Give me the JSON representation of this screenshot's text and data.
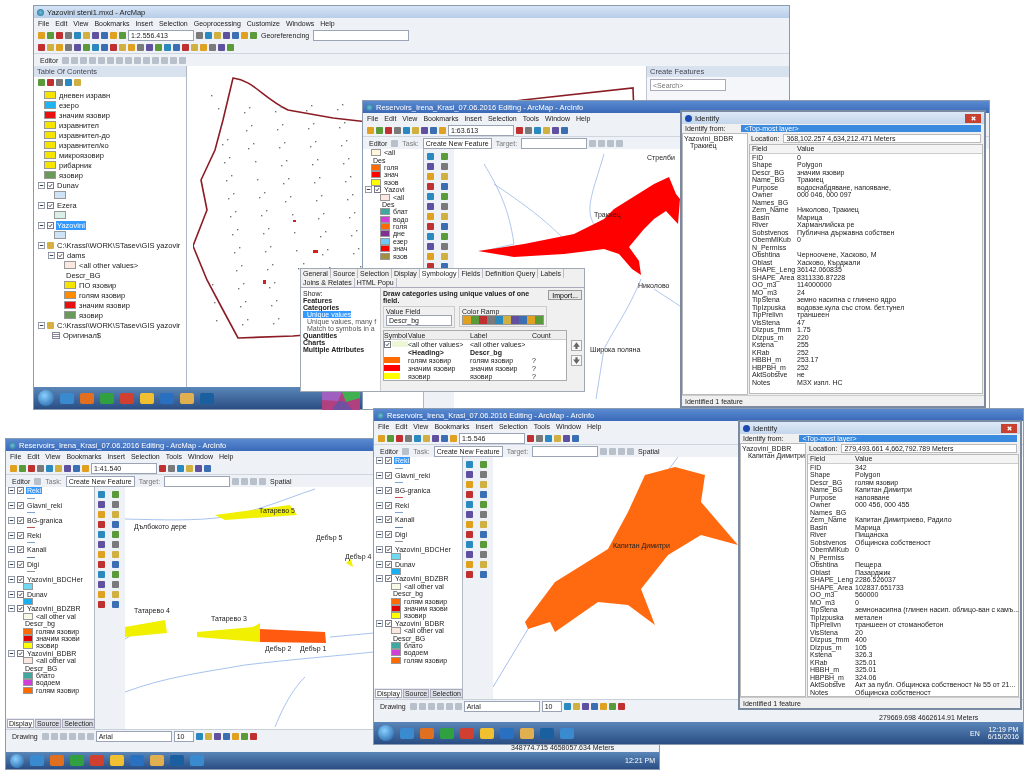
{
  "main_window": {
    "title": "Yazovini steni1.mxd - ArcMap",
    "menu": [
      "File",
      "Edit",
      "View",
      "Bookmarks",
      "Insert",
      "Selection",
      "Geoprocessing",
      "Customize",
      "Windows",
      "Help"
    ],
    "scale": "1:2.556.413",
    "georeferencing": "Georeferencing",
    "editor": "Editor",
    "toc_title": "Table Of Contents",
    "toc": [
      {
        "kind": "legend",
        "color": "#f5e400",
        "label": "дневен изравн"
      },
      {
        "kind": "legend",
        "color": "#1eb4f0",
        "label": "езеро"
      },
      {
        "kind": "legend",
        "color": "#e81010",
        "label": "значим язовир"
      },
      {
        "kind": "legend",
        "color": "#f5e400",
        "label": "изравнител"
      },
      {
        "kind": "legend",
        "color": "#f5e400",
        "label": "изравнител-до"
      },
      {
        "kind": "legend",
        "color": "#f5e400",
        "label": "изравнител/ко"
      },
      {
        "kind": "legend",
        "color": "#f5e400",
        "label": "микроязовир"
      },
      {
        "kind": "legend",
        "color": "#f5e400",
        "label": "рибарник"
      },
      {
        "kind": "legend",
        "color": "#6a9a5a",
        "label": "язовир"
      },
      {
        "kind": "layer",
        "name": "Dunav",
        "checked": true,
        "selected": false,
        "expanded": true,
        "children": [
          {
            "kind": "legend",
            "color": "#cfe3f7"
          }
        ]
      },
      {
        "kind": "layer",
        "name": "Ezera",
        "checked": true,
        "selected": false,
        "expanded": true,
        "children": [
          {
            "kind": "legend",
            "color": "#d8f0e8"
          }
        ]
      },
      {
        "kind": "layer",
        "name": "Yazovini",
        "checked": true,
        "selected": true,
        "expanded": true,
        "children": [
          {
            "kind": "legend",
            "color": "#cfe3f7"
          }
        ]
      },
      {
        "kind": "group",
        "name": "C:\\Krassi\\WORK\\STasev\\GIS yazovir",
        "expanded": true,
        "children": [
          {
            "kind": "layer",
            "name": "dams",
            "checked": true,
            "selected": false,
            "expanded": true,
            "children": [
              {
                "kind": "legend",
                "color": "#fbe8e0",
                "label": "<all other values>"
              },
              {
                "kind": "heading",
                "label": "Descr_BG"
              },
              {
                "kind": "legend",
                "color": "#f5e400",
                "label": "ПО язовир"
              },
              {
                "kind": "legend",
                "color": "#ff8c00",
                "label": "голям язовир"
              },
              {
                "kind": "legend",
                "color": "#e81010",
                "label": "значим язовир"
              },
              {
                "kind": "legend",
                "color": "#6a9a5a",
                "label": "язовир"
              }
            ]
          }
        ]
      },
      {
        "kind": "group",
        "name": "C:\\Krassi\\WORK\\STasev\\GIS yazovir",
        "expanded": true,
        "children": [
          {
            "kind": "table",
            "label": "Оригинал$"
          }
        ]
      }
    ],
    "create_features": {
      "title": "Create Features",
      "placeholder": "<Search>"
    }
  },
  "layer_properties": {
    "tabs": [
      {
        "label": "General",
        "selected": false
      },
      {
        "label": "Source",
        "selected": false
      },
      {
        "label": "Selection",
        "selected": false
      },
      {
        "label": "Display",
        "selected": false
      },
      {
        "label": "Symbology",
        "selected": true
      },
      {
        "label": "Fields",
        "selected": false
      },
      {
        "label": "Definition Query",
        "selected": false
      },
      {
        "label": "Labels",
        "selected": false
      },
      {
        "label": "Joins & Relates",
        "selected": false
      },
      {
        "label": "HTML Popu",
        "selected": false
      }
    ],
    "show_label": "Show:",
    "show_items": [
      {
        "kind": "heading",
        "label": "Features",
        "selected": false
      },
      {
        "kind": "heading",
        "label": "Categories",
        "selected": false
      },
      {
        "kind": "item",
        "label": "Unique values",
        "selected": true
      },
      {
        "kind": "item",
        "label": "Unique values, many f",
        "selected": false
      },
      {
        "kind": "item",
        "label": "Match to symbols in a",
        "selected": false
      },
      {
        "kind": "heading",
        "label": "Quantities",
        "selected": false
      },
      {
        "kind": "heading",
        "label": "Charts",
        "selected": false
      },
      {
        "kind": "heading",
        "label": "Multiple Attributes",
        "selected": false
      }
    ],
    "description": "Draw categories using unique values of one field.",
    "import": "Import...",
    "value_field_label": "Value Field",
    "value_field": "Descr_bg",
    "color_ramp_label": "Color Ramp",
    "columns": [
      "Symbol",
      "Value",
      "Label",
      "Count"
    ],
    "rows": [
      {
        "kind": "check",
        "checked": true,
        "color": "#eef6d8",
        "value": "<all other values>",
        "label": "<all other values>"
      },
      {
        "kind": "heading",
        "value": "<Heading>",
        "label": "Descr_bg"
      },
      {
        "kind": "symbol",
        "color": "#ff6a00",
        "value": "голям язовир",
        "label": "голям язовир",
        "count": "?"
      },
      {
        "kind": "symbol",
        "color": "#ff0000",
        "value": "значим язовир",
        "label": "значим язовир",
        "count": "?"
      },
      {
        "kind": "symbol",
        "color": "#ffff00",
        "value": "язовир",
        "label": "язовир",
        "count": "?"
      }
    ]
  },
  "arcinfo_windows": [
    {
      "title": "Reservoirs_Irena_Krasi_07.06.2016 Editing - ArcMap - ArcInfo",
      "menu": [
        "File",
        "Edit",
        "View",
        "Bookmarks",
        "Insert",
        "Selection",
        "Tools",
        "Window",
        "Help"
      ],
      "scale": "1:63.613",
      "editor": "Editor",
      "task_label": "Task:",
      "task": "Create New Feature",
      "target_label": "Target:",
      "toc": [
        {
          "kind": "legend",
          "color": "#fff6dc",
          "label": "<all"
        },
        {
          "kind": "heading",
          "label": "Des"
        },
        {
          "kind": "legend",
          "color": "#ff6a00",
          "label": "голя"
        },
        {
          "kind": "legend",
          "color": "#ff0000",
          "label": "знач"
        },
        {
          "kind": "legend",
          "color": "#ffff00",
          "label": "язов"
        },
        {
          "kind": "layer",
          "name": "Yazovi",
          "checked": true,
          "selected": false,
          "expanded": true,
          "children": [
            {
              "kind": "legend",
              "color": "#fbe8e0",
              "label": "<all"
            },
            {
              "kind": "heading",
              "label": "Des"
            },
            {
              "kind": "legend",
              "color": "#3fa8a0",
              "label": "блат"
            },
            {
              "kind": "legend",
              "color": "#d040d8",
              "label": "водо"
            },
            {
              "kind": "legend",
              "color": "#ff6a00",
              "label": "голя"
            },
            {
              "kind": "legend",
              "color": "#803090",
              "label": "дне"
            },
            {
              "kind": "legend",
              "color": "#70c8f8",
              "label": "езер"
            },
            {
              "kind": "legend",
              "color": "#ff0000",
              "label": "знач"
            },
            {
              "kind": "legend",
              "color": "#a09040",
              "label": "язов"
            }
          ]
        }
      ],
      "map": {
        "kind": "red_reservoir",
        "labels": [
          "Стрелби",
          "Тракиец",
          "Николово",
          "Широка поляна"
        ]
      }
    },
    {
      "title": "Reservoirs_Irena_Krasi_07.06.2016 Editing - ArcMap - ArcInfo",
      "menu": [
        "File",
        "Edit",
        "View",
        "Bookmarks",
        "Insert",
        "Selection",
        "Tools",
        "Window",
        "Help"
      ],
      "scale": "1:41.540",
      "editor": "Editor",
      "task_label": "Task:",
      "task": "Create New Feature",
      "target_label": "Target:",
      "spatial": "Spatial",
      "toc": [
        {
          "kind": "layer",
          "name": "Reki",
          "checked": true,
          "selected": true,
          "expanded": true,
          "children": [
            {
              "kind": "line",
              "color": "#7aa6d6"
            }
          ]
        },
        {
          "kind": "layer",
          "name": "Glavni_reki",
          "checked": true,
          "selected": false,
          "expanded": true,
          "children": [
            {
              "kind": "line",
              "color": "#7aa6d6"
            }
          ]
        },
        {
          "kind": "layer",
          "name": "BG-granica",
          "checked": true,
          "selected": false,
          "expanded": true,
          "children": [
            {
              "kind": "line",
              "color": "#c85050"
            }
          ]
        },
        {
          "kind": "layer",
          "name": "Reki",
          "checked": true,
          "selected": false,
          "expanded": true,
          "children": [
            {
              "kind": "line",
              "color": "#7aa6d6"
            }
          ]
        },
        {
          "kind": "layer",
          "name": "Kanali",
          "checked": true,
          "selected": false,
          "expanded": true,
          "children": [
            {
              "kind": "line",
              "color": "#6080a0"
            }
          ]
        },
        {
          "kind": "layer",
          "name": "Digi",
          "checked": true,
          "selected": false,
          "expanded": true,
          "children": [
            {
              "kind": "line",
              "color": "#909090"
            }
          ]
        },
        {
          "kind": "layer",
          "name": "Yazovini_BDCHer",
          "checked": true,
          "selected": false,
          "expanded": true,
          "children": [
            {
              "kind": "legend",
              "color": "#70d8f0"
            }
          ]
        },
        {
          "kind": "layer",
          "name": "Dunav",
          "checked": true,
          "selected": false,
          "expanded": true,
          "children": [
            {
              "kind": "legend",
              "color": "#18b0f0"
            }
          ]
        },
        {
          "kind": "layer",
          "name": "Yazovini_BDZBR",
          "checked": true,
          "selected": false,
          "expanded": true,
          "children": [
            {
              "kind": "legend",
              "color": "#f6fbe8",
              "label": "<all other val"
            },
            {
              "kind": "heading",
              "label": "Descr_bg"
            },
            {
              "kind": "legend",
              "color": "#ff6a00",
              "label": "голям язовир"
            },
            {
              "kind": "legend",
              "color": "#e00000",
              "label": "значим язови"
            },
            {
              "kind": "legend",
              "color": "#ffff00",
              "label": "язовир"
            }
          ]
        },
        {
          "kind": "layer",
          "name": "Yazovini_BDBR",
          "checked": true,
          "selected": false,
          "expanded": true,
          "children": [
            {
              "kind": "legend",
              "color": "#fbe8e0",
              "label": "<all other val"
            },
            {
              "kind": "heading",
              "label": "Descr_BG"
            },
            {
              "kind": "legend",
              "color": "#3fa8a0",
              "label": "блато"
            },
            {
              "kind": "legend",
              "color": "#d040d8",
              "label": "водоем"
            },
            {
              "kind": "legend",
              "color": "#ff6a00",
              "label": "голям язовир"
            }
          ]
        }
      ],
      "toc_tabs": [
        {
          "label": "Display",
          "selected": true
        },
        {
          "label": "Source",
          "selected": false
        },
        {
          "label": "Selection",
          "selected": false
        }
      ],
      "drawing": {
        "label": "Drawing",
        "font": "Arial",
        "size": "10"
      },
      "map": {
        "kind": "strips",
        "labels": [
          "Татарево 5",
          "Дълбокото дере",
          "Дебър 5",
          "Дебър 4",
          "Татарево 4",
          "Татарево 3",
          "Дебър 2",
          "Дебър 1"
        ]
      },
      "status": "348774.715 4658057.634 Meters",
      "clock": "12:21 PM"
    },
    {
      "title": "Reservoirs_Irena_Krasi_07.06.2016 Editing - ArcMap - ArcInfo",
      "menu": [
        "File",
        "Edit",
        "View",
        "Bookmarks",
        "Insert",
        "Selection",
        "Tools",
        "Window",
        "Help"
      ],
      "scale": "1:5.546",
      "editor": "Editor",
      "task_label": "Task:",
      "task": "Create New Feature",
      "target_label": "Target:",
      "spatial": "Spatial",
      "toc": [
        {
          "kind": "layer",
          "name": "Reki",
          "checked": true,
          "selected": true,
          "expanded": true,
          "children": [
            {
              "kind": "line",
              "color": "#7aa6d6"
            }
          ]
        },
        {
          "kind": "layer",
          "name": "Glavni_reki",
          "checked": true,
          "selected": false,
          "expanded": true,
          "children": [
            {
              "kind": "line",
              "color": "#7aa6d6"
            }
          ]
        },
        {
          "kind": "layer",
          "name": "BG-granica",
          "checked": true,
          "selected": false,
          "expanded": true,
          "children": [
            {
              "kind": "line",
              "color": "#c85050"
            }
          ]
        },
        {
          "kind": "layer",
          "name": "Reki",
          "checked": true,
          "selected": false,
          "expanded": true,
          "children": [
            {
              "kind": "line",
              "color": "#7aa6d6"
            }
          ]
        },
        {
          "kind": "layer",
          "name": "Kanali",
          "checked": true,
          "selected": false,
          "expanded": true,
          "children": [
            {
              "kind": "line",
              "color": "#6080a0"
            }
          ]
        },
        {
          "kind": "layer",
          "name": "Digi",
          "checked": true,
          "selected": false,
          "expanded": true,
          "children": [
            {
              "kind": "line",
              "color": "#909090"
            }
          ]
        },
        {
          "kind": "layer",
          "name": "Yazovini_BDCHer",
          "checked": true,
          "selected": false,
          "expanded": true,
          "children": [
            {
              "kind": "legend",
              "color": "#70d8f0"
            }
          ]
        },
        {
          "kind": "layer",
          "name": "Dunav",
          "checked": true,
          "selected": false,
          "expanded": true,
          "children": [
            {
              "kind": "legend",
              "color": "#18b0f0"
            }
          ]
        },
        {
          "kind": "layer",
          "name": "Yazovini_BDZBR",
          "checked": true,
          "selected": false,
          "expanded": true,
          "children": [
            {
              "kind": "legend",
              "color": "#f6fbe8",
              "label": "<all other val"
            },
            {
              "kind": "heading",
              "label": "Descr_bg"
            },
            {
              "kind": "legend",
              "color": "#ff6a00",
              "label": "голям язовир"
            },
            {
              "kind": "legend",
              "color": "#e00000",
              "label": "значим язови"
            },
            {
              "kind": "legend",
              "color": "#ffff00",
              "label": "язовир"
            }
          ]
        },
        {
          "kind": "layer",
          "name": "Yazovini_BDBR",
          "checked": true,
          "selected": false,
          "expanded": true,
          "children": [
            {
              "kind": "legend",
              "color": "#fbe8e0",
              "label": "<all other val"
            },
            {
              "kind": "heading",
              "label": "Descr_BG"
            },
            {
              "kind": "legend",
              "color": "#3fa8a0",
              "label": "блато"
            },
            {
              "kind": "legend",
              "color": "#d040d8",
              "label": "водоем"
            },
            {
              "kind": "legend",
              "color": "#ff6a00",
              "label": "голям язовир"
            }
          ]
        }
      ],
      "toc_tabs": [
        {
          "label": "Display",
          "selected": true
        },
        {
          "label": "Source",
          "selected": false
        },
        {
          "label": "Selection",
          "selected": false
        }
      ],
      "drawing": {
        "label": "Drawing",
        "font": "Arial",
        "size": "10"
      },
      "map": {
        "kind": "orange_reservoir",
        "labels": [
          "Капитан Димитри"
        ]
      },
      "status": "279669.698 4662614.91 Meters",
      "lang": "EN",
      "clock": "12:19 PM",
      "date": "6/15/2016"
    }
  ],
  "identify_windows": [
    {
      "title": "Identify",
      "from_label": "Identify from:",
      "from": "<Top-most layer>",
      "layer": "Yazovini_BDBR",
      "feature": "Тракиец",
      "location_label": "Location:",
      "location": "368,102.257  4,634,212.471 Meters",
      "columns": [
        "Field",
        "Value"
      ],
      "rows": [
        {
          "field": "FID",
          "value": "0"
        },
        {
          "field": "Shape",
          "value": "Polygon"
        },
        {
          "field": "Descr_BG",
          "value": "значим язовир"
        },
        {
          "field": "Name_BG",
          "value": "Тракиец"
        },
        {
          "field": "Purpose",
          "value": "водоснабдяване, напояване,"
        },
        {
          "field": "Owner",
          "value": "000 046, 000 097"
        },
        {
          "field": "Names_BG"
        },
        {
          "field": "Zem_Name",
          "value": "Николово, Тракиец"
        },
        {
          "field": "Basin",
          "value": "Марица"
        },
        {
          "field": "River",
          "value": "Харманлийска ре"
        },
        {
          "field": "Sobstvenos",
          "value": "Публична държавна собствен"
        },
        {
          "field": "ObemMlKub",
          "value": "0"
        },
        {
          "field": "N_Permiss"
        },
        {
          "field": "Obshtina",
          "value": "Черноочене, Хасково, М"
        },
        {
          "field": "Oblast",
          "value": "Хасково, Кърджали"
        },
        {
          "field": "SHAPE_Leng",
          "value": "36142.060835"
        },
        {
          "field": "SHAPE_Area",
          "value": "8311336.87228"
        },
        {
          "field": "OO_m3",
          "value": "114000000"
        },
        {
          "field": "MO_m3",
          "value": "24"
        },
        {
          "field": "TipStena",
          "value": "земно насипна с глинено ядро"
        },
        {
          "field": "TipIzpuska",
          "value": "водовзе.кула със стом. бет.тунел"
        },
        {
          "field": "TipPrelivn",
          "value": "траншеен"
        },
        {
          "field": "VisStena",
          "value": "47"
        },
        {
          "field": "DIzpus_fmm",
          "value": "1.75"
        },
        {
          "field": "DIzpus_m",
          "value": "220"
        },
        {
          "field": "Kstena",
          "value": "255"
        },
        {
          "field": "KRab",
          "value": "252"
        },
        {
          "field": "HBBH_m",
          "value": "253.17"
        },
        {
          "field": "HBPBH_m",
          "value": "252"
        },
        {
          "field": "AktSobstve",
          "value": "не"
        },
        {
          "field": "Notes",
          "value": "МЗХ изпл. НС"
        }
      ],
      "status": "Identified 1 feature"
    },
    {
      "title": "Identify",
      "from_label": "Identify from:",
      "from": "<Top-most layer>",
      "layer": "Yazovini_BDBR",
      "feature": "Капитан Димитри",
      "location_label": "Location:",
      "location": "279,493.661  4,662,792.789 Meters",
      "columns": [
        "Field",
        "Value"
      ],
      "rows": [
        {
          "field": "FID",
          "value": "342"
        },
        {
          "field": "Shape",
          "value": "Polygon"
        },
        {
          "field": "Descr_BG",
          "value": "голям язовир"
        },
        {
          "field": "Name_BG",
          "value": "Капитан Димитри"
        },
        {
          "field": "Purpose",
          "value": "напояване"
        },
        {
          "field": "Owner",
          "value": "000 456, 000 455"
        },
        {
          "field": "Names_BG"
        },
        {
          "field": "Zem_Name",
          "value": "Капитан Димитриево, Радило"
        },
        {
          "field": "Basin",
          "value": "Марица"
        },
        {
          "field": "River",
          "value": "Пищанска"
        },
        {
          "field": "Sobstvenos",
          "value": "Общинска собственост"
        },
        {
          "field": "ObemMlKub",
          "value": "0"
        },
        {
          "field": "N_Permiss"
        },
        {
          "field": "Obshtina",
          "value": "Пещера"
        },
        {
          "field": "Oblast",
          "value": "Пазарджик"
        },
        {
          "field": "SHAPE_Leng",
          "value": "2286.526037"
        },
        {
          "field": "SHAPE_Area",
          "value": "102837.651733"
        },
        {
          "field": "OO_m3",
          "value": "560000"
        },
        {
          "field": "MO_m3",
          "value": "0"
        },
        {
          "field": "TipStena",
          "value": "земнонасипна (глинен насип. облицо-ван с камъ..."
        },
        {
          "field": "TipIzpuska",
          "value": "метален"
        },
        {
          "field": "TipPrelivn",
          "value": "траншеен от стоманобетон"
        },
        {
          "field": "VisStena",
          "value": "20"
        },
        {
          "field": "DIzpus_fmm",
          "value": "400"
        },
        {
          "field": "DIzpus_m",
          "value": "105"
        },
        {
          "field": "Kstena",
          "value": "326.3"
        },
        {
          "field": "KRab",
          "value": "325.01"
        },
        {
          "field": "HBBH_m",
          "value": "325.01"
        },
        {
          "field": "HBPBH_m",
          "value": "324.06"
        },
        {
          "field": "AktSobstve",
          "value": "Акт за публ. Общинска собственост № 55 от 21..."
        },
        {
          "field": "Notes",
          "value": "Общинска собственост"
        }
      ],
      "status": "Identified 1 feature"
    }
  ]
}
